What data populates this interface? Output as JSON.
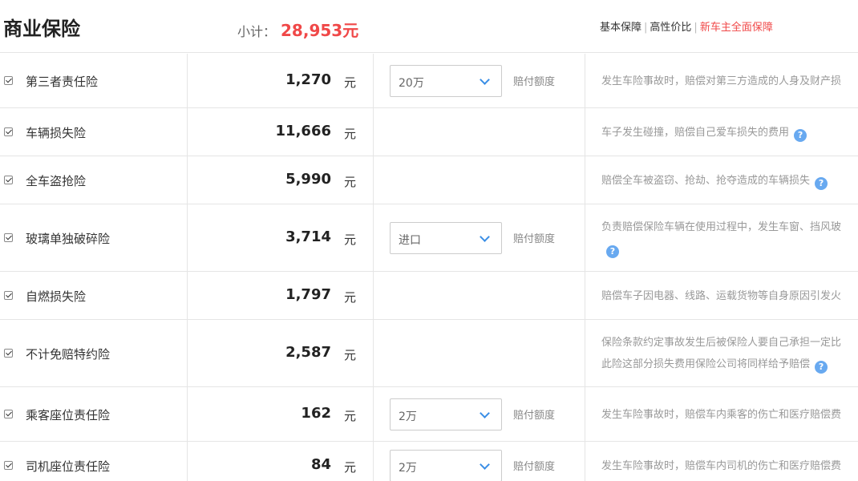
{
  "header": {
    "title": "商业保险",
    "subtotal_label": "小计：",
    "subtotal_value": "28,953元",
    "plans": [
      "基本保障",
      "高性价比",
      "新车主全面保障"
    ],
    "active_plan_index": 2
  },
  "unit_label": "元",
  "limit_label": "赔付额度",
  "rows": [
    {
      "name": "第三者责任险",
      "price": "1,270",
      "select": "20万",
      "desc": [
        "发生车险事故时，赔偿对第三方造成的人身及财产损"
      ],
      "help": false
    },
    {
      "name": "车辆损失险",
      "price": "11,666",
      "select": null,
      "desc": [
        "车子发生碰撞，赔偿自己爱车损失的费用"
      ],
      "help": true
    },
    {
      "name": "全车盗抢险",
      "price": "5,990",
      "select": null,
      "desc": [
        "赔偿全车被盗窃、抢劫、抢夺造成的车辆损失"
      ],
      "help": true
    },
    {
      "name": "玻璃单独破碎险",
      "price": "3,714",
      "select": "进口",
      "desc": [
        "负责赔偿保险车辆在使用过程中，发生车窗、挡风玻",
        ""
      ],
      "help": true
    },
    {
      "name": "自燃损失险",
      "price": "1,797",
      "select": null,
      "desc": [
        "赔偿车子因电器、线路、运载货物等自身原因引发火"
      ],
      "help": false
    },
    {
      "name": "不计免赔特约险",
      "price": "2,587",
      "select": null,
      "desc": [
        "保险条款约定事故发生后被保险人要自己承担一定比",
        "此险这部分损失费用保险公司将同样给予赔偿"
      ],
      "help": true
    },
    {
      "name": "乘客座位责任险",
      "price": "162",
      "select": "2万",
      "desc": [
        "发生车险事故时，赔偿车内乘客的伤亡和医疗赔偿费"
      ],
      "help": false
    },
    {
      "name": "司机座位责任险",
      "price": "84",
      "select": "2万",
      "desc": [
        "发生车险事故时，赔偿车内司机的伤亡和医疗赔偿费"
      ],
      "help": false
    }
  ],
  "colors": {
    "accent_red": "#f04848",
    "help_blue": "#68a9f0",
    "chevron_blue": "#3a8ee6"
  }
}
